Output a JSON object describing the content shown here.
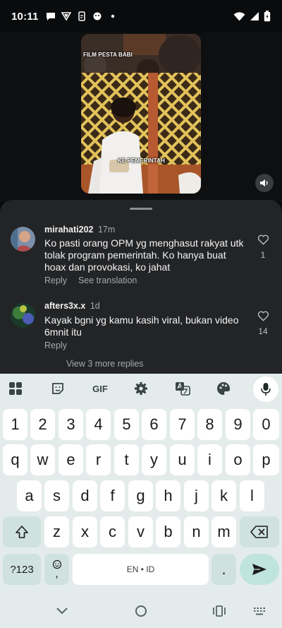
{
  "status_bar": {
    "time": "10:11"
  },
  "video": {
    "top_caption": "FILM PESTA BABI",
    "bottom_caption": "KE PEMERINTAH"
  },
  "comments": [
    {
      "username": "mirahati202",
      "time_ago": "17m",
      "text": "Ko pasti orang OPM yg menghasut rakyat utk tolak program pemerintah. Ko hanya buat hoax dan provokasi, ko jahat",
      "reply_label": "Reply",
      "translate_label": "See translation",
      "likes": "1"
    },
    {
      "username": "afters3x.x",
      "time_ago": "1d",
      "text": "Kayak bgni yg kamu kasih viral, bukan video 6mnit itu",
      "reply_label": "Reply",
      "likes": "14"
    }
  ],
  "view_more_replies": "View 3 more replies",
  "keyboard": {
    "gif_label": "GIF",
    "row_numbers": [
      "1",
      "2",
      "3",
      "4",
      "5",
      "6",
      "7",
      "8",
      "9",
      "0"
    ],
    "row1": [
      "q",
      "w",
      "e",
      "r",
      "t",
      "y",
      "u",
      "i",
      "o",
      "p"
    ],
    "row2": [
      "a",
      "s",
      "d",
      "f",
      "g",
      "h",
      "j",
      "k",
      "l"
    ],
    "row3": [
      "z",
      "x",
      "c",
      "v",
      "b",
      "n",
      "m"
    ],
    "symbols_label": "?123",
    "comma_label": ",",
    "space_label": "EN • ID",
    "period_label": "."
  },
  "colors": {
    "sheet_bg": "#232426",
    "keyboard_bg": "#e4eceb",
    "enter_key": "#bfe4dd",
    "function_key": "#cfe2df"
  }
}
